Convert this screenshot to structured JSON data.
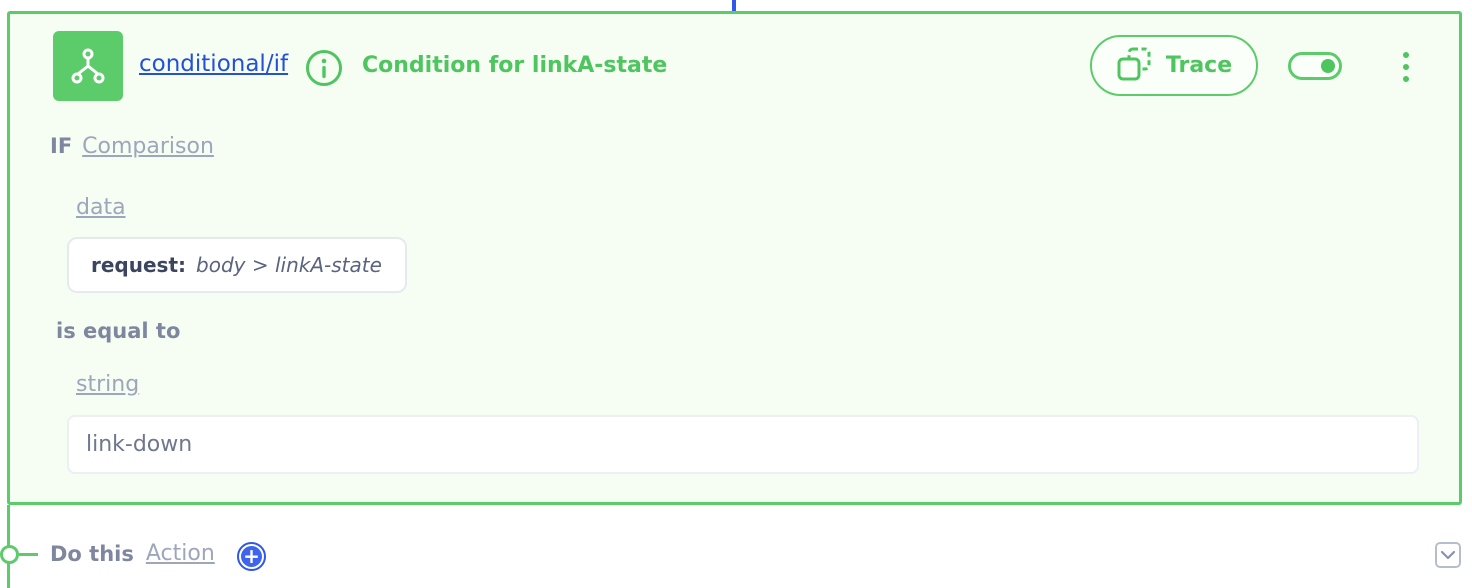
{
  "node": {
    "type_label": "conditional/if",
    "title": "Condition for linkA-state",
    "trace_label": "Trace",
    "enabled": true
  },
  "condition": {
    "if_label": "IF",
    "comparison_label": "Comparison",
    "left_type": "data",
    "request_key": "request:",
    "request_path": "body > linkA-state",
    "operator": "is equal to",
    "right_type": "string",
    "value": "link-down"
  },
  "branch": {
    "do_label": "Do this",
    "action_label": "Action"
  },
  "icons": {
    "node": "branch-icon",
    "info": "info-icon",
    "trace": "trace-icon",
    "more": "more-vertical-icon",
    "add": "plus-circle-icon",
    "collapse": "chevron-down-icon"
  },
  "colors": {
    "accent_green": "#5ccb6a",
    "link_blue": "#2450d8",
    "add_blue": "#3f65ef",
    "muted_text": "#7e879f"
  }
}
